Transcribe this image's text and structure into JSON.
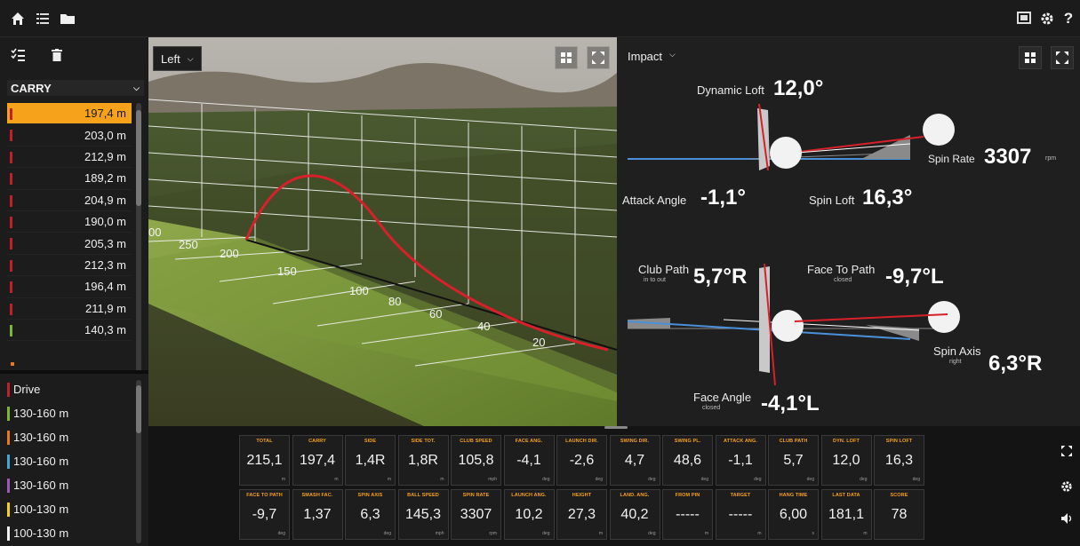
{
  "toolbar": {
    "left_icons": [
      "home-icon",
      "list-icon",
      "folder-icon"
    ],
    "right_icons": [
      "monitor-icon",
      "gear-icon",
      "help-icon"
    ],
    "help_glyph": "?"
  },
  "left_panel": {
    "carry_label": "CARRY",
    "shots": [
      {
        "value": "197,4 m",
        "color": "#c0202a",
        "selected": true
      },
      {
        "value": "203,0 m",
        "color": "#c0202a"
      },
      {
        "value": "212,9 m",
        "color": "#c0202a"
      },
      {
        "value": "189,2 m",
        "color": "#c0202a"
      },
      {
        "value": "204,9 m",
        "color": "#c0202a"
      },
      {
        "value": "190,0 m",
        "color": "#c0202a"
      },
      {
        "value": "205,3 m",
        "color": "#c0202a"
      },
      {
        "value": "212,3 m",
        "color": "#c0202a"
      },
      {
        "value": "196,4 m",
        "color": "#c0202a"
      },
      {
        "value": "211,9 m",
        "color": "#c0202a"
      },
      {
        "value": "140,3 m",
        "color": "#7cb82f"
      }
    ],
    "clubs": [
      {
        "label": "Drive",
        "color": "#c0202a"
      },
      {
        "label": "130-160 m",
        "color": "#7cb82f"
      },
      {
        "label": "130-160 m",
        "color": "#e87722"
      },
      {
        "label": "130-160 m",
        "color": "#3fa9d6"
      },
      {
        "label": "130-160 m",
        "color": "#9b59b6"
      },
      {
        "label": "100-130 m",
        "color": "#f2d024"
      },
      {
        "label": "100-130 m",
        "color": "#f0f0f0"
      }
    ]
  },
  "view3d": {
    "view_label": "Left",
    "distance_labels": [
      "250",
      "200",
      "150",
      "100",
      "80",
      "60",
      "40",
      "20"
    ],
    "partial_label": "00",
    "trajectory_color": "#d8202a"
  },
  "impact": {
    "mode_label": "Impact",
    "dynamic_loft": {
      "label": "Dynamic Loft",
      "value": "12,0°"
    },
    "spin_rate": {
      "label": "Spin Rate",
      "value": "3307",
      "unit": "rpm"
    },
    "attack_angle": {
      "label": "Attack Angle",
      "value": "-1,1°"
    },
    "spin_loft": {
      "label": "Spin Loft",
      "value": "16,3°"
    },
    "club_path": {
      "label": "Club Path",
      "value": "5,7°R",
      "sub": "in to out"
    },
    "face_to_path": {
      "label": "Face To Path",
      "value": "-9,7°L",
      "sub": "closed"
    },
    "spin_axis": {
      "label": "Spin Axis",
      "value": "6,3°R",
      "sub": "right"
    },
    "face_angle": {
      "label": "Face Angle",
      "value": "-4,1°L",
      "sub": "closed"
    }
  },
  "tiles_row1": [
    {
      "label": "TOTAL",
      "value": "215,1",
      "unit": "m"
    },
    {
      "label": "CARRY",
      "value": "197,4",
      "unit": "m"
    },
    {
      "label": "SIDE",
      "value": "1,4R",
      "unit": "m"
    },
    {
      "label": "SIDE TOT.",
      "value": "1,8R",
      "unit": "m"
    },
    {
      "label": "CLUB SPEED",
      "value": "105,8",
      "unit": "mph"
    },
    {
      "label": "FACE ANG.",
      "value": "-4,1",
      "unit": "deg"
    },
    {
      "label": "LAUNCH DIR.",
      "value": "-2,6",
      "unit": "deg"
    },
    {
      "label": "SWING DIR.",
      "value": "4,7",
      "unit": "deg"
    },
    {
      "label": "SWING PL.",
      "value": "48,6",
      "unit": "deg"
    },
    {
      "label": "ATTACK ANG.",
      "value": "-1,1",
      "unit": "deg"
    },
    {
      "label": "CLUB PATH",
      "value": "5,7",
      "unit": "deg"
    },
    {
      "label": "DYN. LOFT",
      "value": "12,0",
      "unit": "deg"
    },
    {
      "label": "SPIN LOFT",
      "value": "16,3",
      "unit": "deg"
    }
  ],
  "tiles_row2": [
    {
      "label": "FACE TO PATH",
      "value": "-9,7",
      "unit": "deg"
    },
    {
      "label": "SMASH FAC.",
      "value": "1,37",
      "unit": ""
    },
    {
      "label": "SPIN AXIS",
      "value": "6,3",
      "unit": "deg"
    },
    {
      "label": "BALL SPEED",
      "value": "145,3",
      "unit": "mph"
    },
    {
      "label": "SPIN RATE",
      "value": "3307",
      "unit": "rpm"
    },
    {
      "label": "LAUNCH ANG.",
      "value": "10,2",
      "unit": "deg"
    },
    {
      "label": "HEIGHT",
      "value": "27,3",
      "unit": "m"
    },
    {
      "label": "LAND. ANG.",
      "value": "40,2",
      "unit": "deg"
    },
    {
      "label": "FROM PIN",
      "value": "-----",
      "unit": "m"
    },
    {
      "label": "TARGET",
      "value": "-----",
      "unit": "m"
    },
    {
      "label": "HANG TIME",
      "value": "6,00",
      "unit": "s"
    },
    {
      "label": "LAST DATA",
      "value": "181,1",
      "unit": "m"
    },
    {
      "label": "SCORE",
      "value": "78",
      "unit": ""
    }
  ]
}
